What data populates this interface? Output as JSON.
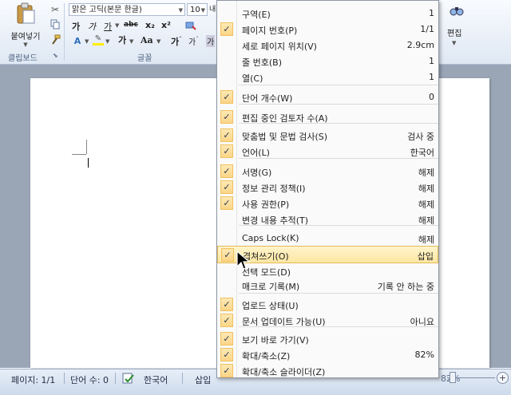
{
  "ribbon": {
    "font_name": "맑은 고딕(본문 한글)",
    "font_size": "10",
    "cut_tail": "내",
    "paste_label": "붙여넣기",
    "clipboard_group": "클립보드",
    "font_group": "글꼴",
    "edit_label": "편집",
    "format_row1": [
      "가",
      "가",
      "가",
      "abc",
      "x₂",
      "x²"
    ],
    "format_row2": [
      "가",
      "Aa"
    ]
  },
  "menu": {
    "items": [
      {
        "label": "구역(E)",
        "value": "1",
        "checked": false
      },
      {
        "label": "페이지 번호(P)",
        "value": "1/1",
        "checked": true
      },
      {
        "label": "세로 페이지 위치(V)",
        "value": "2.9cm",
        "checked": false
      },
      {
        "label": "줄 번호(B)",
        "value": "1",
        "checked": false
      },
      {
        "label": "열(C)",
        "value": "1",
        "checked": false
      },
      {
        "label": "단어 개수(W)",
        "value": "0",
        "checked": true
      },
      {
        "label": "편집 중인 검토자 수(A)",
        "value": "",
        "checked": true
      },
      {
        "label": "맞춤법 및 문법 검사(S)",
        "value": "검사 중",
        "checked": true
      },
      {
        "label": "언어(L)",
        "value": "한국어",
        "checked": true
      },
      {
        "label": "서명(G)",
        "value": "해제",
        "checked": true
      },
      {
        "label": "정보 관리 정책(I)",
        "value": "해제",
        "checked": true
      },
      {
        "label": "사용 권한(P)",
        "value": "해제",
        "checked": true
      },
      {
        "label": "변경 내용 추적(T)",
        "value": "해제",
        "checked": false
      },
      {
        "label": "Caps Lock(K)",
        "value": "해제",
        "checked": false
      },
      {
        "label": "겹쳐쓰기(O)",
        "value": "삽입",
        "checked": true
      },
      {
        "label": "선택 모드(D)",
        "value": "",
        "checked": false
      },
      {
        "label": "매크로 기록(M)",
        "value": "기록 안 하는 중",
        "checked": false
      },
      {
        "label": "업로드 상태(U)",
        "value": "",
        "checked": true
      },
      {
        "label": "문서 업데이트 가능(U)",
        "value": "아니요",
        "checked": true
      },
      {
        "label": "보기 바로 가기(V)",
        "value": "",
        "checked": true
      },
      {
        "label": "확대/축소(Z)",
        "value": "82%",
        "checked": true
      },
      {
        "label": "확대/축소 슬라이더(Z)",
        "value": "",
        "checked": true
      }
    ]
  },
  "status": {
    "page": "페이지: 1/1",
    "words": "단어 수: 0",
    "language": "한국어",
    "mode": "삽입",
    "zoom": "82%"
  },
  "colors": {
    "accent_highlight": "#fce6a2",
    "highlighter": "#ffee00",
    "font_color": "#d42020"
  },
  "icons": [
    "paste-icon",
    "cut-icon",
    "copy-icon",
    "format-painter-icon",
    "find-icon",
    "proofing-icon",
    "zoom-in-icon",
    "grid-view-icon"
  ]
}
